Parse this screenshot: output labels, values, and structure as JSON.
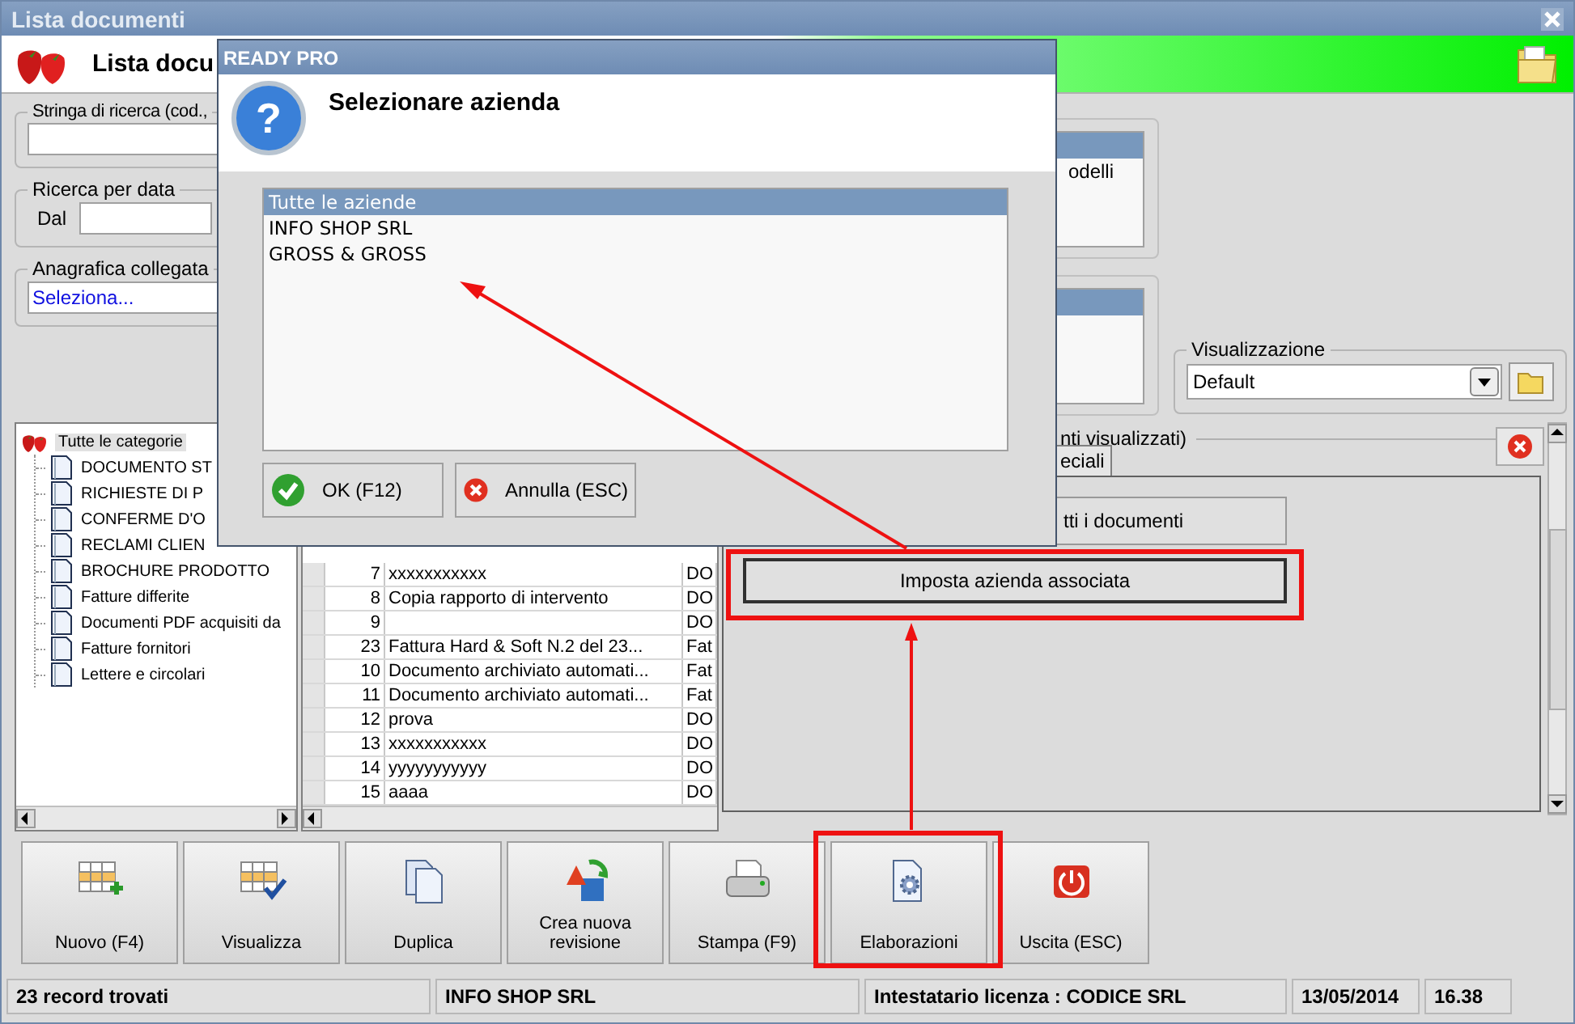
{
  "window": {
    "title": "Lista documenti"
  },
  "header": {
    "title": "Lista docu"
  },
  "filters": {
    "search": {
      "label": "Stringa di ricerca (cod.,"
    },
    "date": {
      "label": "Ricerca per data",
      "from_label": "Dal"
    },
    "linked": {
      "label": "Anagrafica collegata",
      "value": "Seleziona..."
    }
  },
  "right_lists": [
    {
      "items": [
        {
          "selected": true
        },
        {
          "label": "odelli",
          "selected": false
        }
      ]
    },
    {
      "items": [
        {
          "selected": true
        }
      ]
    }
  ],
  "view": {
    "label": "Visualizzazione",
    "value": "Default"
  },
  "tree": {
    "items": [
      {
        "label": "Tutte le categorie",
        "selected": true,
        "children": [
          {
            "label": "DOCUMENTO ST",
            "selected": false
          },
          {
            "label": "RICHIESTE DI P",
            "selected": false
          },
          {
            "label": "CONFERME D'O",
            "selected": false
          },
          {
            "label": "RECLAMI CLIEN",
            "selected": false
          },
          {
            "label": "BROCHURE PRODOTTO",
            "selected": false
          },
          {
            "label": "Fatture differite",
            "selected": false
          },
          {
            "label": "Documenti PDF acquisiti da",
            "selected": false
          },
          {
            "label": "Fatture fornitori",
            "selected": false
          },
          {
            "label": "Lettere e circolari",
            "selected": false
          }
        ]
      }
    ]
  },
  "table": {
    "rows": [
      {
        "number": "7",
        "description": "xxxxxxxxxxx",
        "column_3": "DO"
      },
      {
        "number": "8",
        "description": "Copia rapporto di intervento",
        "column_3": "DO"
      },
      {
        "number": "9",
        "column_3": "DO"
      },
      {
        "number": "23",
        "description": "Fattura Hard & Soft N.2 del 23...",
        "column_3": "Fat"
      },
      {
        "number": "10",
        "description": "Documento archiviato automati...",
        "column_3": "Fat"
      },
      {
        "number": "11",
        "description": "Documento archiviato automati...",
        "column_3": "Fat"
      },
      {
        "number": "12",
        "description": "prova",
        "column_3": "DO"
      },
      {
        "number": "13",
        "description": "xxxxxxxxxxx",
        "column_3": "DO"
      },
      {
        "number": "14",
        "description": "yyyyyyyyyyy",
        "column_3": "DO"
      },
      {
        "number": "15",
        "description": "aaaa",
        "column_3": "DO"
      }
    ]
  },
  "results_panel": {
    "label": "nti visualizzati)",
    "tab": {
      "label": "eciali",
      "selected": true
    },
    "buttons": [
      {
        "label": "tti i documenti",
        "kind": "partial"
      },
      {
        "label": "Imposta azienda associata",
        "kind": "focused"
      }
    ]
  },
  "toolbar": [
    {
      "label": "Nuovo (F4)",
      "kind": "new"
    },
    {
      "label": "Visualizza",
      "kind": "view"
    },
    {
      "label": "Duplica",
      "kind": "duplicate"
    },
    {
      "label": "Crea nuova revisione",
      "kind": "revision"
    },
    {
      "label": "Stampa (F9)",
      "kind": "print"
    },
    {
      "label": "Elaborazioni",
      "kind": "process"
    },
    {
      "label": "Uscita (ESC)",
      "kind": "exit"
    }
  ],
  "status_bar": [
    "23 record trovati",
    "INFO SHOP SRL",
    "Intestatario licenza : CODICE SRL",
    "13/05/2014",
    "16.38"
  ],
  "dialog": {
    "title": "READY PRO",
    "icon": "?",
    "message": "Selezionare azienda",
    "items": [
      {
        "label": "Tutte le aziende",
        "selected": true
      },
      {
        "label": "INFO SHOP SRL",
        "selected": false
      },
      {
        "label": "GROSS & GROSS",
        "selected": false
      }
    ],
    "buttons": [
      {
        "label": "OK (F12)",
        "kind": "ok"
      },
      {
        "label": "Annulla (ESC)",
        "kind": "cancel"
      }
    ]
  }
}
